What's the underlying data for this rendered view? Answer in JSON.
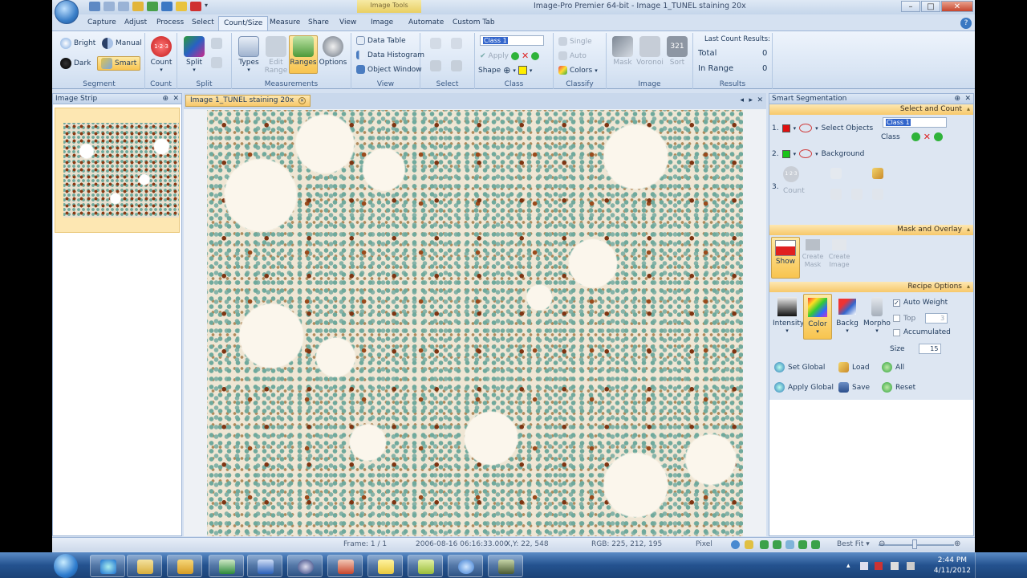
{
  "window": {
    "title": "Image-Pro Premier 64-bit - Image 1_TUNEL staining 20x",
    "context_tab": "Image Tools",
    "minimize": "–",
    "maximize": "□",
    "close": "✕"
  },
  "ribbon_tabs": [
    "Capture",
    "Adjust",
    "Process",
    "Select",
    "Count/Size",
    "Measure",
    "Share",
    "View",
    "Image",
    "Automate",
    "Custom Tab"
  ],
  "active_tab": "Count/Size",
  "help_label": "?",
  "ribbon": {
    "segment": {
      "label": "Segment",
      "bright": "Bright",
      "manual": "Manual",
      "dark": "Dark",
      "smart": "Smart"
    },
    "count": {
      "label": "Count",
      "count": "Count",
      "badge": "1·2·3"
    },
    "split": {
      "label": "Split",
      "split": "Split"
    },
    "measurements": {
      "label": "Measurements",
      "types": "Types",
      "edit_range": "Edit Range",
      "ranges": "Ranges",
      "options": "Options"
    },
    "view": {
      "label": "View",
      "data_table": "Data Table",
      "data_histogram": "Data Histogram",
      "object_window": "Object Window"
    },
    "select": {
      "label": "Select"
    },
    "class": {
      "label": "Class",
      "class_value": "Class 1",
      "apply": "Apply",
      "shape": "Shape"
    },
    "classify": {
      "label": "Classify",
      "single": "Single",
      "auto": "Auto",
      "colors": "Colors"
    },
    "image": {
      "label": "Image",
      "mask": "Mask",
      "voronoi": "Voronoi",
      "sort": "Sort",
      "badge": "321"
    },
    "results": {
      "label": "Results",
      "heading": "Last Count Results:",
      "total_label": "Total",
      "total_value": "0",
      "in_range_label": "In Range",
      "in_range_value": "0"
    }
  },
  "image_strip": {
    "title": "Image Strip",
    "pin": "⊕",
    "close": "✕"
  },
  "document": {
    "tab": "Image 1_TUNEL staining 20x",
    "nav_prev": "◂",
    "nav_next": "▸",
    "close": "✕"
  },
  "smart_segmentation": {
    "title": "Smart Segmentation",
    "select_and_count": "Select and Count",
    "row1_num": "1.",
    "row1_label": "Select Objects",
    "class_value": "Class 1",
    "class_label": "Class",
    "row2_num": "2.",
    "row2_label": "Background",
    "row3_num": "3.",
    "count_label": "Count",
    "mask_and_overlay": "Mask and Overlay",
    "show": "Show",
    "create_mask": "Create Mask",
    "create_image": "Create Image",
    "recipe_options": "Recipe Options",
    "intensity": "Intensity",
    "color": "Color",
    "backg": "Backg",
    "morpho": "Morpho",
    "auto_weight": "Auto Weight",
    "top": "Top",
    "top_value": "3",
    "accumulated": "Accumulated",
    "size_label": "Size",
    "size_value": "15",
    "set_global": "Set Global",
    "load": "Load",
    "all": "All",
    "apply_global": "Apply Global",
    "save": "Save",
    "reset": "Reset"
  },
  "status": {
    "frame": "Frame: 1 / 1",
    "datetime": "2006-08-16 06:16:33.000",
    "xy": "X,Y:   22, 548",
    "rgb": "RGB:  225,  212,  195",
    "unit": "Pixel",
    "zoom": "Best Fit"
  },
  "taskbar": {
    "time": "2:44 PM",
    "date": "4/11/2012"
  },
  "colors": {
    "accent": "#f8c44f",
    "class1": "#e01010",
    "background_class": "#19c419",
    "cell_green": "#6fa99c",
    "cell_brown": "#8a3a14"
  }
}
